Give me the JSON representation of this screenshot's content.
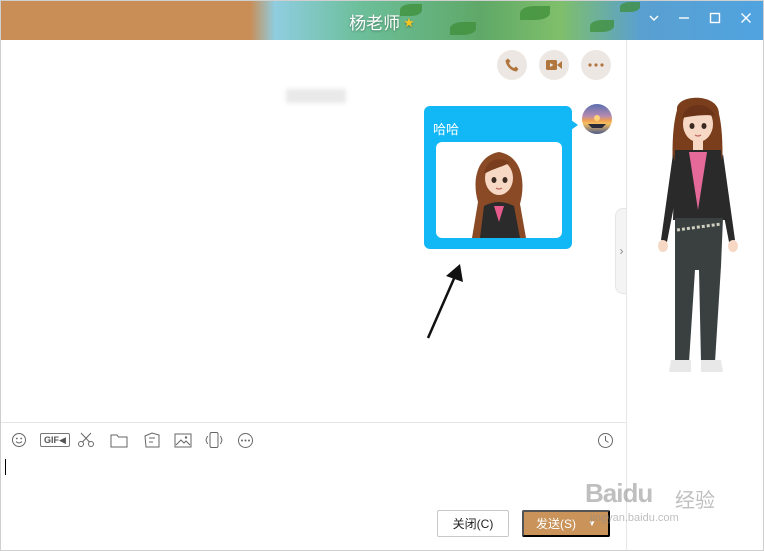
{
  "window": {
    "title": "杨老师",
    "title_badge_icon": "star-icon",
    "controls": [
      "chevron-down-icon",
      "minimize-icon",
      "maximize-icon",
      "close-icon"
    ]
  },
  "header_actions": [
    {
      "name": "voice-call-button",
      "icon": "phone-icon"
    },
    {
      "name": "video-call-button",
      "icon": "video-camera-icon"
    },
    {
      "name": "more-button",
      "icon": "ellipsis-icon"
    }
  ],
  "messages": [
    {
      "direction": "outgoing",
      "text": "哈哈",
      "has_image": true,
      "image": "cartoon-girl-sticker"
    }
  ],
  "toolbar": {
    "items": [
      "emoji-icon",
      "gif-icon",
      "screenshot-scissors-icon",
      "folder-icon",
      "doodle-icon",
      "image-icon",
      "shake-window-icon",
      "more-icon"
    ],
    "gif_label": "GIF",
    "right_item": "history-clock-icon"
  },
  "input": {
    "value": ""
  },
  "buttons": {
    "close_label": "关闭(C)",
    "send_label": "发送(S)",
    "send_dropdown": "▼"
  },
  "side_panel": {
    "show": "show-character"
  },
  "watermark": {
    "brand": "Baidu",
    "cn": "经验",
    "url": "jingyan.baidu.com"
  },
  "colors": {
    "bubble": "#12b7f5",
    "send_button": "#c9935a",
    "titlebar_left": "#c98d56"
  }
}
